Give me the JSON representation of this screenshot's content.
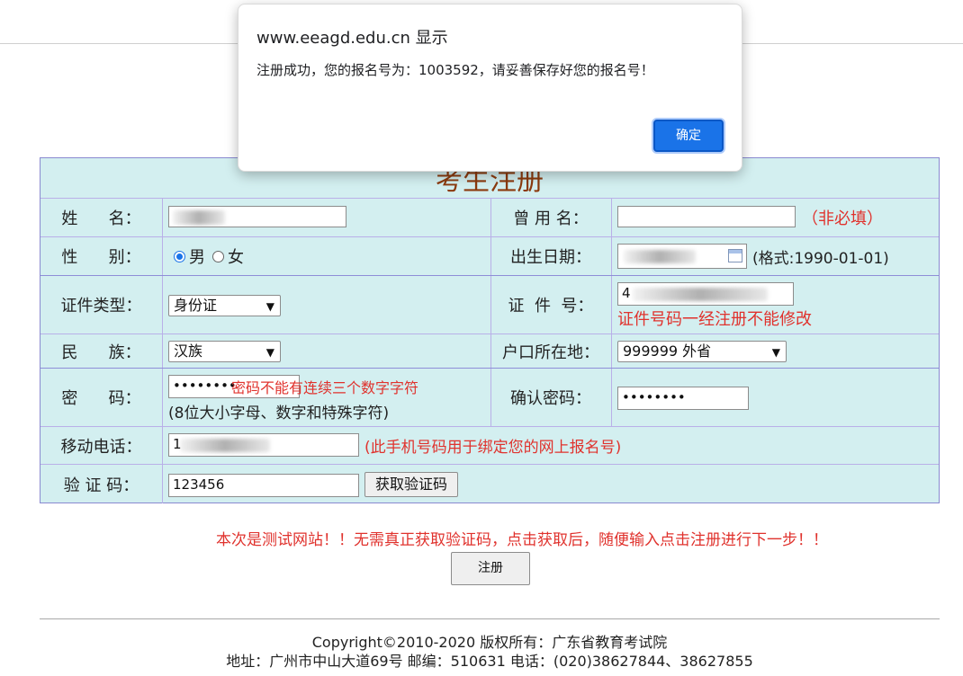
{
  "dialog": {
    "title": "www.eeagd.edu.cn 显示",
    "message": "注册成功，您的报名号为：1003592，请妥善保存好您的报名号！",
    "ok_label": "确定"
  },
  "form": {
    "title": "考生注册",
    "name_label": "姓      名：",
    "former_name_label": "曾 用 名：",
    "former_name_note": "（非必填）",
    "gender_label": "性      别：",
    "gender_male": "男",
    "gender_female": "女",
    "birth_label": "出生日期：",
    "birth_format": "(格式:1990-01-01)",
    "id_type_label": "证件类型：",
    "id_type_value": "身份证",
    "id_no_label": "证  件  号：",
    "id_no_prefix": "4",
    "id_no_note": "证件号码一经注册不能修改",
    "ethnic_label": "民      族：",
    "ethnic_value": "汉族",
    "hukou_label": "户口所在地：",
    "hukou_value": "999999 外省",
    "password_label": "密      码：",
    "password_value": "••••••••",
    "password_warning": "密码不能有连续三个数字字符",
    "password_rule": "(8位大小字母、数字和特殊字符)",
    "confirm_label": "确认密码：",
    "confirm_value": "••••••••",
    "phone_label": "移动电话：",
    "phone_prefix": "1",
    "phone_note": "(此手机号码用于绑定您的网上报名号)",
    "code_label": "验 证 码：",
    "code_value": "123456",
    "get_code_label": "获取验证码"
  },
  "notice": "本次是测试网站！！无需真正获取验证码，点击获取后，随便输入点击注册进行下一步！！",
  "register_label": "注册",
  "footer": {
    "copyright": "Copyright©2010-2020 版权所有：广东省教育考试院",
    "address": "地址：广州市中山大道69号 邮编：510631 电话：(020)38627844、38627855"
  }
}
